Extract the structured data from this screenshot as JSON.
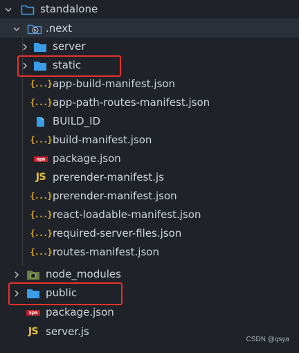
{
  "explorer": {
    "root": {
      "label": "standalone",
      "icon": "folder-open-outline-icon"
    },
    "next": {
      "label": ".next",
      "icon": "folder-next-open-icon"
    },
    "items": [
      {
        "label": "server",
        "icon": "folder-icon"
      },
      {
        "label": "static",
        "icon": "folder-icon"
      },
      {
        "label": "app-build-manifest.json",
        "icon": "json-icon"
      },
      {
        "label": "app-path-routes-manifest.json",
        "icon": "json-icon"
      },
      {
        "label": "BUILD_ID",
        "icon": "file-icon"
      },
      {
        "label": "build-manifest.json",
        "icon": "json-icon"
      },
      {
        "label": "package.json",
        "icon": "npm-icon"
      },
      {
        "label": "prerender-manifest.js",
        "icon": "js-icon"
      },
      {
        "label": "prerender-manifest.json",
        "icon": "json-icon"
      },
      {
        "label": "react-loadable-manifest.json",
        "icon": "json-icon"
      },
      {
        "label": "required-server-files.json",
        "icon": "json-icon"
      },
      {
        "label": "routes-manifest.json",
        "icon": "json-icon"
      }
    ],
    "root_items": [
      {
        "label": "node_modules",
        "icon": "node-folder-icon"
      },
      {
        "label": "public",
        "icon": "folder-icon"
      },
      {
        "label": "package.json",
        "icon": "npm-icon"
      },
      {
        "label": "server.js",
        "icon": "js-icon"
      }
    ],
    "icon_glyphs": {
      "json": "{...}",
      "js": "JS",
      "npm": "npm"
    }
  },
  "watermark": "CSDN @qsya",
  "colors": {
    "background": "#1f2329",
    "folder": "#3b9de8",
    "highlight_box": "#e5312a",
    "json_icon": "#e0a924",
    "js_icon": "#e8c23f",
    "npm_icon": "#c12127"
  }
}
